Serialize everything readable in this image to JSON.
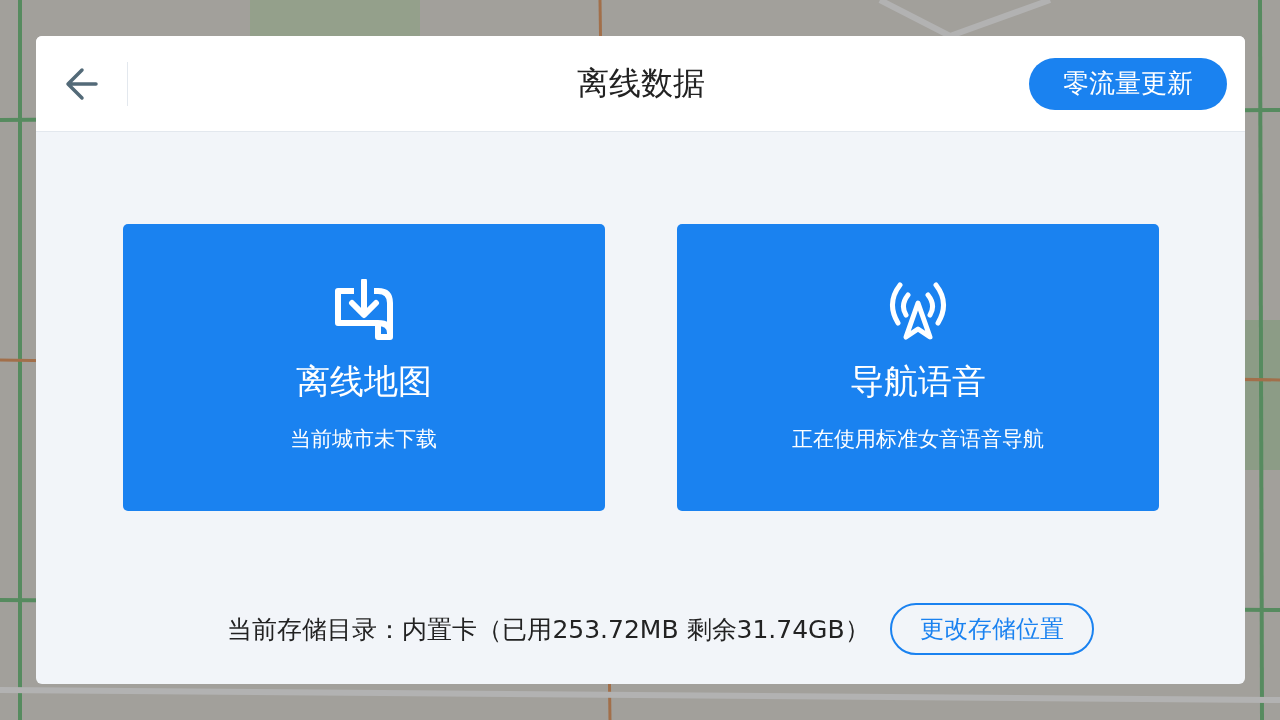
{
  "header": {
    "title": "离线数据",
    "action": "零流量更新"
  },
  "cards": [
    {
      "kind": "download",
      "title": "离线地图",
      "subtitle": "当前城市未下载"
    },
    {
      "kind": "signal",
      "title": "导航语音",
      "subtitle": "正在使用标准女音语音导航"
    }
  ],
  "footer": {
    "storage": "当前存储目录：内置卡（已用253.72MB 剩余31.74GB）",
    "button": "更改存储位置"
  }
}
